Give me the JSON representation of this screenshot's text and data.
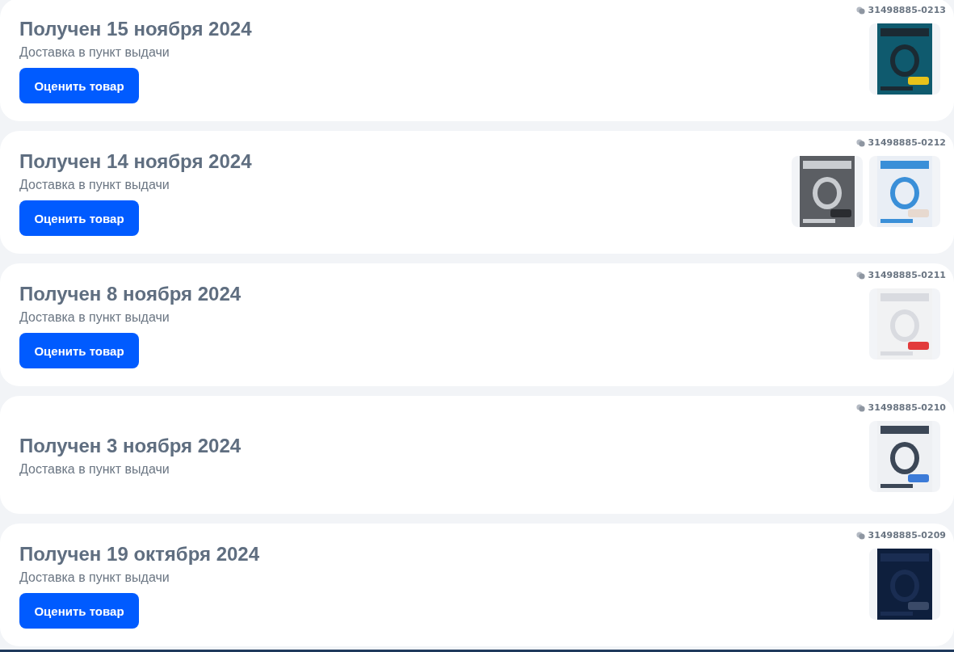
{
  "orders": [
    {
      "title": "Получен 15 ноября 2024",
      "delivery": "Доставка в пункт выдачи",
      "button": "Оценить товар",
      "number": "31498885-0213"
    },
    {
      "title": "Получен 14 ноября 2024",
      "delivery": "Доставка в пункт выдачи",
      "button": "Оценить товар",
      "number": "31498885-0212"
    },
    {
      "title": "Получен 8 ноября 2024",
      "delivery": "Доставка в пункт выдачи",
      "button": "Оценить товар",
      "number": "31498885-0211"
    },
    {
      "title": "Получен 3 ноября 2024",
      "delivery": "Доставка в пункт выдачи",
      "number": "31498885-0210"
    },
    {
      "title": "Получен 19 октября 2024",
      "delivery": "Доставка в пункт выдачи",
      "button": "Оценить товар",
      "number": "31498885-0209"
    }
  ]
}
